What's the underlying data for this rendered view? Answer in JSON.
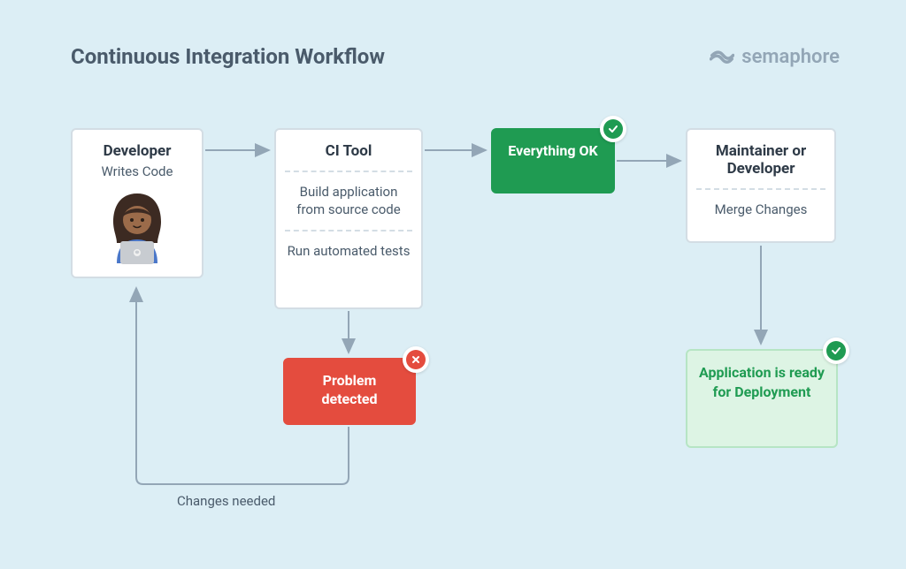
{
  "title": "Continuous Integration Workflow",
  "brand": "semaphore",
  "developer": {
    "title": "Developer",
    "subtitle": "Writes Code"
  },
  "ci_tool": {
    "title": "CI Tool",
    "step1": "Build application from source code",
    "step2": "Run automated tests"
  },
  "ok": {
    "text": "Everything OK"
  },
  "maintainer": {
    "title": "Maintainer or Developer",
    "action": "Merge Changes"
  },
  "problem": {
    "text": "Problem detected"
  },
  "ready": {
    "text": "Application is ready for Deployment"
  },
  "changes_label": "Changes needed",
  "colors": {
    "bg": "#dceef5",
    "success": "#1f9b52",
    "error": "#e44c3e",
    "arrow": "#93a6b6"
  }
}
